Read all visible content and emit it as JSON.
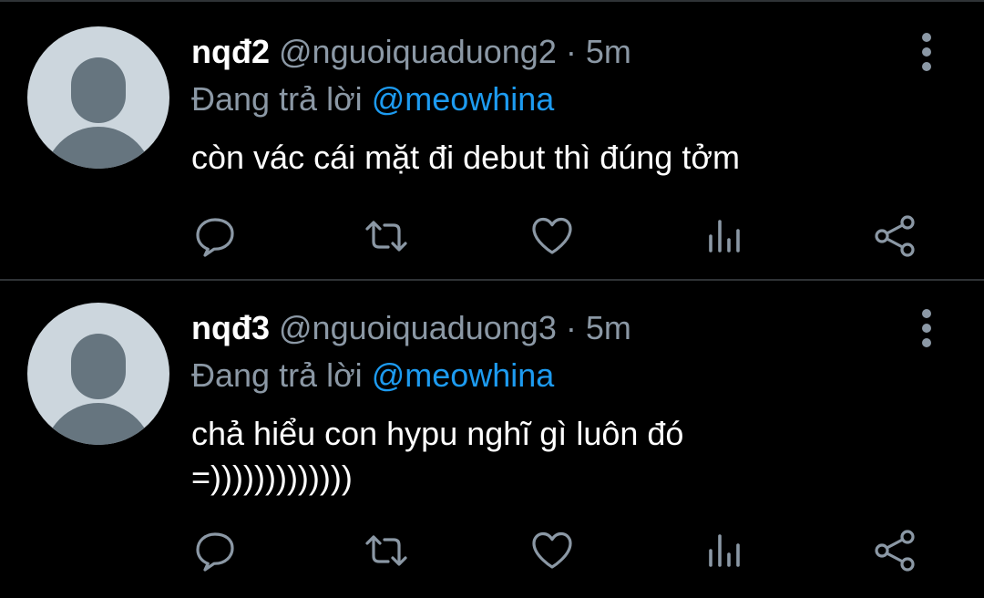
{
  "tweets": [
    {
      "display_name": "nqđ2",
      "handle": "@nguoiquaduong2",
      "separator": "·",
      "time": "5m",
      "replying_prefix": "Đang trả lời ",
      "replying_to": "@meowhina",
      "text": "còn vác cái mặt đi debut thì đúng tởm",
      "avatar": "default-avatar",
      "actions": [
        "reply-icon",
        "retweet-icon",
        "like-icon",
        "views-icon",
        "share-icon"
      ]
    },
    {
      "display_name": "nqđ3",
      "handle": "@nguoiquaduong3",
      "separator": "·",
      "time": "5m",
      "replying_prefix": "Đang trả lời ",
      "replying_to": "@meowhina",
      "text": "chả hiểu con hypu nghĩ gì luôn đó\n=)))))))))))))",
      "avatar": "default-avatar",
      "actions": [
        "reply-icon",
        "retweet-icon",
        "like-icon",
        "views-icon",
        "share-icon"
      ]
    }
  ],
  "colors": {
    "background": "#000000",
    "text_primary": "#ffffff",
    "text_secondary": "#8b98a5",
    "mention": "#1d9bf0",
    "divider": "#2f3336",
    "avatar_bg": "#ccd6dd",
    "avatar_fg": "#66757f"
  }
}
